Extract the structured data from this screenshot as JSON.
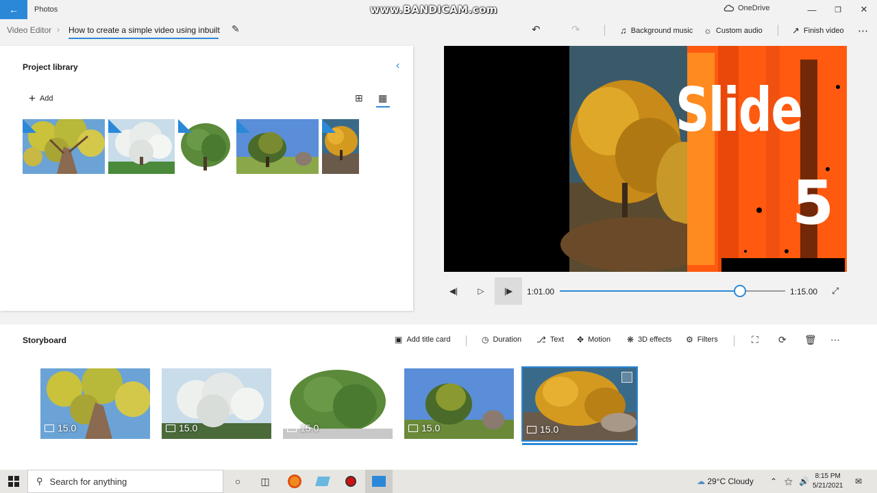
{
  "titlebar": {
    "app_name": "Photos",
    "watermark": "www.BANDICAM.com",
    "onedrive_label": "OneDrive"
  },
  "commandbar": {
    "breadcrumb_root": "Video Editor",
    "project_title": "How to create a simple video using inbuilt",
    "background_music": "Background music",
    "custom_audio": "Custom audio",
    "finish_video": "Finish video"
  },
  "library": {
    "title": "Project library",
    "add_label": "Add"
  },
  "preview": {
    "slide_word": "Slide",
    "slide_number": "5",
    "current_time": "1:01.00",
    "total_time": "1:15.00",
    "progress": 0.8
  },
  "storyboard": {
    "title": "Storyboard",
    "add_title_card": "Add title card",
    "duration": "Duration",
    "text": "Text",
    "motion": "Motion",
    "effects_3d": "3D effects",
    "filters": "Filters",
    "clips": [
      {
        "duration": "15.0"
      },
      {
        "duration": "15.0"
      },
      {
        "duration": "15.0"
      },
      {
        "duration": "15.0"
      },
      {
        "duration": "15.0"
      }
    ]
  },
  "taskbar": {
    "search_placeholder": "Search for anything",
    "weather": "29°C  Cloudy",
    "time": "8:15 PM",
    "date": "5/21/2021"
  },
  "colors": {
    "accent": "#2b88d8",
    "orange": "#ff5a10"
  }
}
